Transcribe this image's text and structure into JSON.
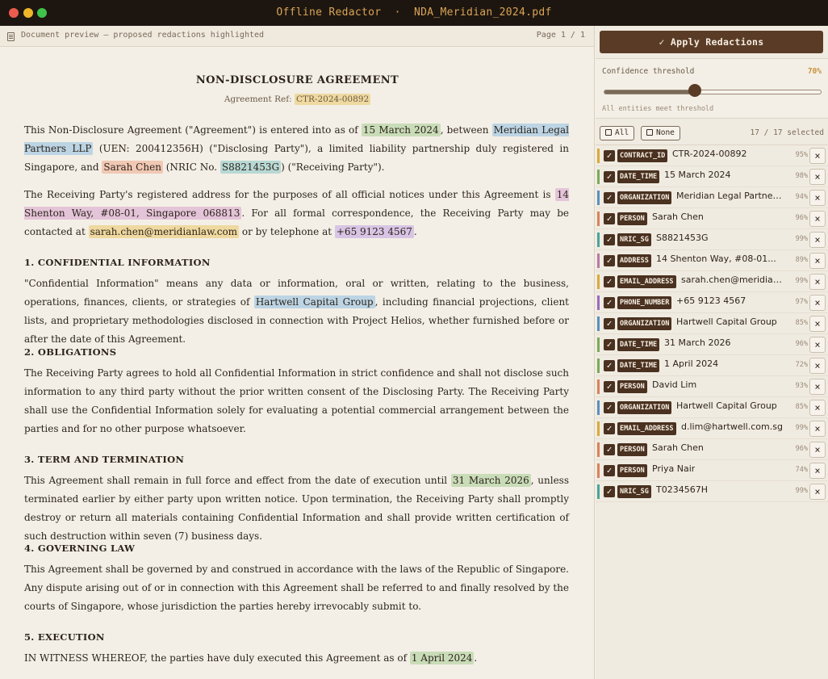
{
  "window": {
    "title": "Offline Redactor  ·  NDA_Meridian_2024.pdf"
  },
  "doc_header": {
    "label": "Document preview  —  proposed redactions highlighted",
    "page": "Page 1 / 1"
  },
  "document": {
    "title": "NON-DISCLOSURE AGREEMENT",
    "ref_label": "Agreement Ref:",
    "ref_value": "CTR-2024-00892",
    "p1": {
      "t1": "This Non-Disclosure Agreement (\"Agreement\") is entered into as of ",
      "h1": "15 March 2024",
      "t2": ", between ",
      "h2": "Meridian Legal Partners LLP",
      "t3": " (UEN: 200412356H) (\"Disclosing Party\"), a limited liability partnership duly registered in Singapore, and ",
      "h3": "Sarah Chen",
      "t4": " (NRIC No. ",
      "h4": "S8821453G",
      "t5": ") (\"Receiving Party\")."
    },
    "p2": {
      "t1": "The Receiving Party's registered address for the purposes of all official notices under this Agreement is ",
      "h1": "14 Shenton Way, #08-01, Singapore 068813",
      "t2": ". For all formal correspondence, the Receiving Party may be contacted at ",
      "h2": "sarah.chen@meridianlaw.com",
      "t3": " or by telephone at ",
      "h3": "+65 9123 4567",
      "t4": "."
    },
    "s1_heading": "1.  CONFIDENTIAL INFORMATION",
    "p3": {
      "t1": "\"Confidential Information\" means any data or information, oral or written, relating to the business, operations, finances, clients, or strategies of ",
      "h1": "Hartwell Capital Group",
      "t2": ", including financial projections, client lists, and proprietary methodologies disclosed in connection with Project Helios, whether furnished before or after the date of this Agreement."
    },
    "s2_heading": "2.  OBLIGATIONS",
    "p4": "The Receiving Party agrees to hold all Confidential Information in strict confidence and shall not disclose such information to any third party without the prior written consent of the Disclosing Party. The Receiving Party shall use the Confidential Information solely for evaluating a potential commercial arrangement between the parties and for no other purpose whatsoever.",
    "s3_heading": "3.  TERM AND TERMINATION",
    "p5": {
      "t1": "This Agreement shall remain in full force and effect from the date of execution until ",
      "h1": "31 March 2026",
      "t2": ", unless terminated earlier by either party upon written notice. Upon termination, the Receiving Party shall promptly destroy or return all materials containing Confidential Information and shall provide written certification of such destruction within seven (7) business days."
    },
    "s4_heading": "4.  GOVERNING LAW",
    "p6": "This Agreement shall be governed by and construed in accordance with the laws of the Republic of Singapore. Any dispute arising out of or in connection with this Agreement shall be referred to and finally resolved by the courts of Singapore, whose jurisdiction the parties hereby irrevocably submit to.",
    "s5_heading": "5.  EXECUTION",
    "p7": {
      "t1": "IN WITNESS WHEREOF, the parties have duly executed this Agreement as of ",
      "h1": "1 April 2024",
      "t2": "."
    }
  },
  "panel": {
    "apply_label": "✓ Apply Redactions",
    "confidence_label": "Confidence threshold",
    "confidence_value": "70%",
    "confidence_fraction": 0.42,
    "confidence_note": "All entities meet threshold",
    "all_label": "All",
    "none_label": "None",
    "selected_count": "17 / 17 selected"
  },
  "entities": [
    {
      "type": "CONTRACT_ID",
      "value": "CTR-2024-00892",
      "pct": "95%",
      "color": "#d9a93a"
    },
    {
      "type": "DATE_TIME",
      "value": "15 March 2024",
      "pct": "98%",
      "color": "#7aab5a"
    },
    {
      "type": "ORGANIZATION",
      "value": "Meridian Legal Partners L...",
      "pct": "94%",
      "color": "#5a8fc0"
    },
    {
      "type": "PERSON",
      "value": "Sarah Chen",
      "pct": "96%",
      "color": "#d9825a"
    },
    {
      "type": "NRIC_SG",
      "value": "S8821453G",
      "pct": "99%",
      "color": "#4aa59a"
    },
    {
      "type": "ADDRESS",
      "value": "14 Shenton Way, #08-01...",
      "pct": "89%",
      "color": "#b87aa8"
    },
    {
      "type": "EMAIL_ADDRESS",
      "value": "sarah.chen@meridianlaw...",
      "pct": "99%",
      "color": "#d9a93a"
    },
    {
      "type": "PHONE_NUMBER",
      "value": "+65 9123 4567",
      "pct": "97%",
      "color": "#9a6ac0"
    },
    {
      "type": "ORGANIZATION",
      "value": "Hartwell Capital Group",
      "pct": "85%",
      "color": "#5a8fc0"
    },
    {
      "type": "DATE_TIME",
      "value": "31 March 2026",
      "pct": "96%",
      "color": "#7aab5a"
    },
    {
      "type": "DATE_TIME",
      "value": "1 April 2024",
      "pct": "72%",
      "color": "#7aab5a"
    },
    {
      "type": "PERSON",
      "value": "David Lim",
      "pct": "93%",
      "color": "#d9825a"
    },
    {
      "type": "ORGANIZATION",
      "value": "Hartwell Capital Group",
      "pct": "85%",
      "color": "#5a8fc0"
    },
    {
      "type": "EMAIL_ADDRESS",
      "value": "d.lim@hartwell.com.sg",
      "pct": "99%",
      "color": "#d9a93a"
    },
    {
      "type": "PERSON",
      "value": "Sarah Chen",
      "pct": "96%",
      "color": "#d9825a"
    },
    {
      "type": "PERSON",
      "value": "Priya Nair",
      "pct": "74%",
      "color": "#d9825a"
    },
    {
      "type": "NRIC_SG",
      "value": "T0234567H",
      "pct": "99%",
      "color": "#4aa59a"
    }
  ]
}
